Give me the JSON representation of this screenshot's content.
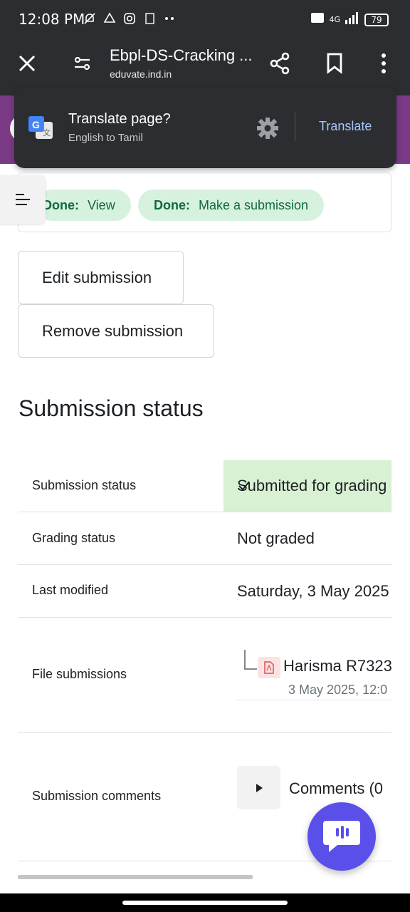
{
  "status_bar": {
    "time": "12:08 PM",
    "network": "4G",
    "battery": "79"
  },
  "browser": {
    "title": "Ebpl-DS-Cracking ...",
    "url": "eduvate.ind.in"
  },
  "translate": {
    "title": "Translate page?",
    "subtitle": "English to Tamil",
    "action": "Translate"
  },
  "completion": {
    "badges": [
      {
        "state": "Done:",
        "label": "View"
      },
      {
        "state": "Done:",
        "label": "Make a submission"
      }
    ]
  },
  "actions": {
    "edit_label": "Edit submission",
    "remove_label": "Remove submission"
  },
  "section": {
    "heading": "Submission status"
  },
  "status_table": {
    "submission_status_label": "Submission status",
    "submission_status_value": "Submitted for grading",
    "grading_status_label": "Grading status",
    "grading_status_value": "Not graded",
    "last_modified_label": "Last modified",
    "last_modified_value": "Saturday, 3 May 2025",
    "file_submissions_label": "File submissions",
    "file_name": "Harisma R7323",
    "file_date": "3 May 2025, 12:0",
    "comments_label": "Submission comments",
    "comments_value": "Comments (0"
  },
  "colors": {
    "brand_purple": "#7b3a86",
    "success_bg": "#d7f1d2",
    "chat_fab": "#5b4fe9"
  }
}
